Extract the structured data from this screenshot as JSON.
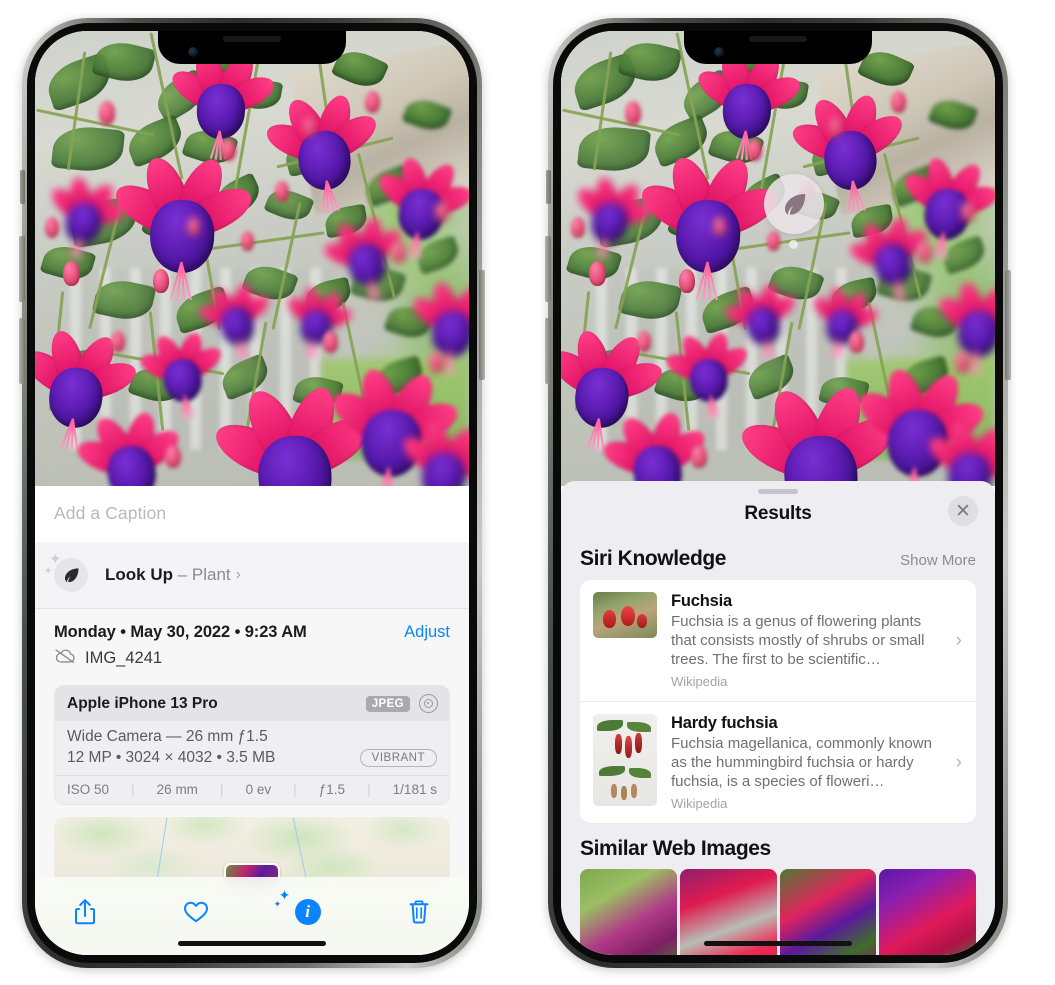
{
  "left_phone": {
    "caption_field": {
      "placeholder": "Add a Caption",
      "value": ""
    },
    "lookup_row": {
      "icon": "leaf-icon",
      "sparkle_icon": "sparkles-icon",
      "label": "Look Up",
      "dash": " – ",
      "subject": "Plant",
      "chevron": "›"
    },
    "meta": {
      "date": "Monday • May 30, 2022 • 9:23 AM",
      "adjust_label": "Adjust",
      "cloud_icon": "icloud-slash-icon",
      "filename": "IMG_4241"
    },
    "exif": {
      "device": "Apple iPhone 13 Pro",
      "format_badge": "JPEG",
      "lens_icon": "lens-icon",
      "lens_line": "Wide Camera — 26 mm ƒ1.5",
      "size_line": "12 MP • 3024 × 4032 • 3.5 MB",
      "style_badge": "VIBRANT",
      "stats": [
        "ISO 50",
        "26 mm",
        "0 ev",
        "ƒ1.5",
        "1/181 s"
      ],
      "separator": "|"
    },
    "map": {
      "pin_label": "photo-location-pin"
    },
    "toolbar": [
      {
        "name": "share-button",
        "icon": "share-icon"
      },
      {
        "name": "favorite-button",
        "icon": "heart-icon"
      },
      {
        "name": "info-button",
        "icon": "info-sparkle-icon",
        "glyph": "i"
      },
      {
        "name": "delete-button",
        "icon": "trash-icon"
      }
    ]
  },
  "right_phone": {
    "badge": {
      "icon": "leaf-icon",
      "name": "visual-look-up-badge"
    },
    "sheet": {
      "grabber": "drag-handle",
      "title": "Results",
      "close_icon": "close-icon"
    },
    "siri_knowledge": {
      "section_title": "Siri Knowledge",
      "show_more": "Show More",
      "results": [
        {
          "title": "Fuchsia",
          "description": "Fuchsia is a genus of flowering plants that consists mostly of shrubs or small trees. The first to be scientific…",
          "source": "Wikipedia",
          "chevron": "›"
        },
        {
          "title": "Hardy fuchsia",
          "description": "Fuchsia magellanica, commonly known as the hummingbird fuchsia or hardy fuchsia, is a species of floweri…",
          "source": "Wikipedia",
          "chevron": "›"
        }
      ]
    },
    "similar_web_images": {
      "section_title": "Similar Web Images",
      "tiles": [
        "fuchsia-thumb-1",
        "fuchsia-thumb-2",
        "fuchsia-thumb-3",
        "fuchsia-thumb-4"
      ]
    }
  },
  "colors": {
    "accent_blue": "#0a84ff",
    "sheet_bg": "#eeeef2",
    "card_white": "#ffffff",
    "muted_text": "#6f6f76",
    "flower_pink": "#e5196a",
    "flower_purple": "#4a15a0"
  }
}
